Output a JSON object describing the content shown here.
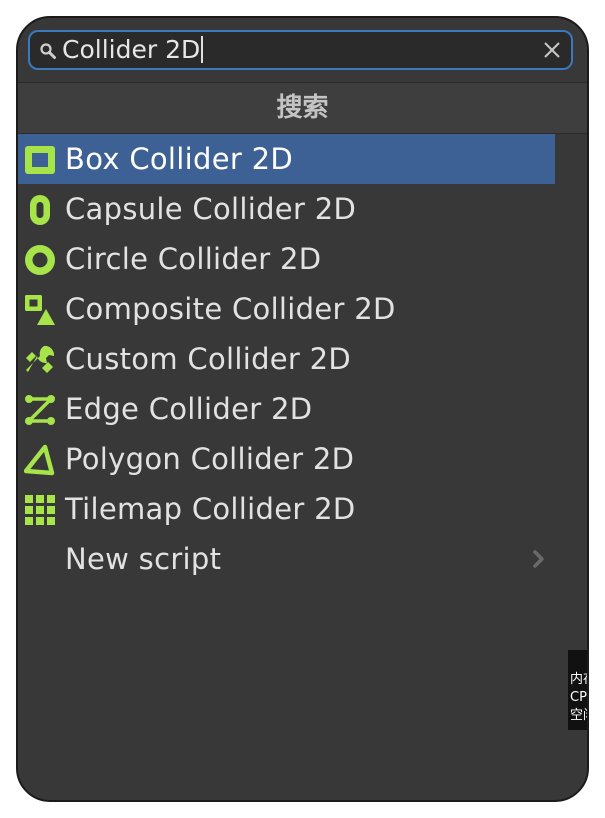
{
  "search": {
    "value": "Collider 2D",
    "icon": "search-icon",
    "clear_icon": "clear-icon"
  },
  "header": {
    "title": "搜索"
  },
  "items": [
    {
      "label": "Box Collider 2D",
      "icon": "box-collider-icon",
      "selected": true
    },
    {
      "label": "Capsule Collider 2D",
      "icon": "capsule-collider-icon",
      "selected": false
    },
    {
      "label": "Circle Collider 2D",
      "icon": "circle-collider-icon",
      "selected": false
    },
    {
      "label": "Composite Collider 2D",
      "icon": "composite-collider-icon",
      "selected": false
    },
    {
      "label": "Custom Collider 2D",
      "icon": "custom-collider-icon",
      "selected": false
    },
    {
      "label": "Edge Collider 2D",
      "icon": "edge-collider-icon",
      "selected": false
    },
    {
      "label": "Polygon Collider 2D",
      "icon": "polygon-collider-icon",
      "selected": false
    },
    {
      "label": "Tilemap Collider 2D",
      "icon": "tilemap-collider-icon",
      "selected": false
    },
    {
      "label": "New script",
      "icon": "chevron-right-icon",
      "selected": false
    }
  ],
  "tooltip": {
    "lines": [
      "内存",
      "CPU",
      "空闲"
    ]
  },
  "colors": {
    "panel_bg": "#383838",
    "selection": "#3e6195",
    "icon_green": "#a6e44a",
    "search_border": "#3a79bb"
  }
}
